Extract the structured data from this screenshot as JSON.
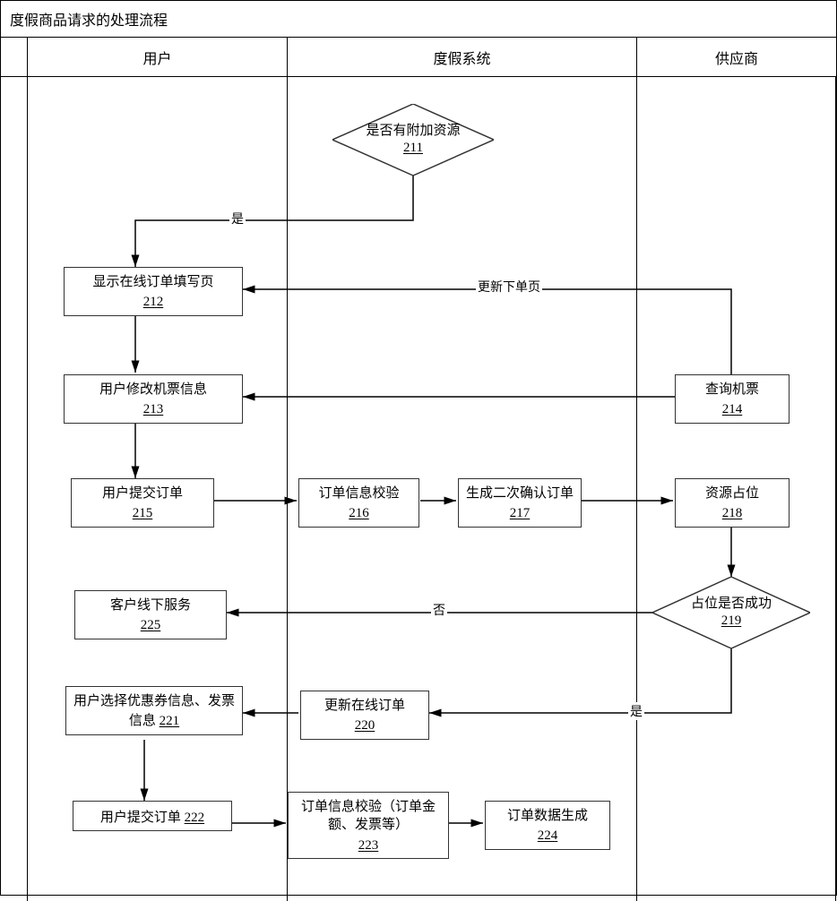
{
  "title": "度假商品请求的处理流程",
  "lanes": {
    "user": "用户",
    "system": "度假系统",
    "supplier": "供应商"
  },
  "nodes": {
    "d211": {
      "label": "是否有附加资源",
      "num": "211"
    },
    "b212": {
      "label": "显示在线订单填写页",
      "num": "212"
    },
    "b213": {
      "label": "用户修改机票信息",
      "num": "213"
    },
    "b214": {
      "label": "查询机票",
      "num": "214"
    },
    "b215": {
      "label": "用户提交订单",
      "num": "215"
    },
    "b216": {
      "label": "订单信息校验",
      "num": "216"
    },
    "b217": {
      "label": "生成二次确认订单",
      "num": "217"
    },
    "b218": {
      "label": "资源占位",
      "num": "218"
    },
    "d219": {
      "label": "占位是否成功",
      "num": "219"
    },
    "b220": {
      "label": "更新在线订单",
      "num": "220"
    },
    "b221": {
      "label": "用户选择优惠券信息、发票信息",
      "num": "221"
    },
    "b222": {
      "label": "用户提交订单",
      "num": "222"
    },
    "b223": {
      "label": "订单信息校验（订单金额、发票等）",
      "num": "223"
    },
    "b224": {
      "label": "订单数据生成",
      "num": "224"
    },
    "b225": {
      "label": "客户线下服务",
      "num": "225"
    }
  },
  "edgeLabels": {
    "yes211": "是",
    "updatePage": "更新下单页",
    "no219": "否",
    "yes219": "是"
  }
}
